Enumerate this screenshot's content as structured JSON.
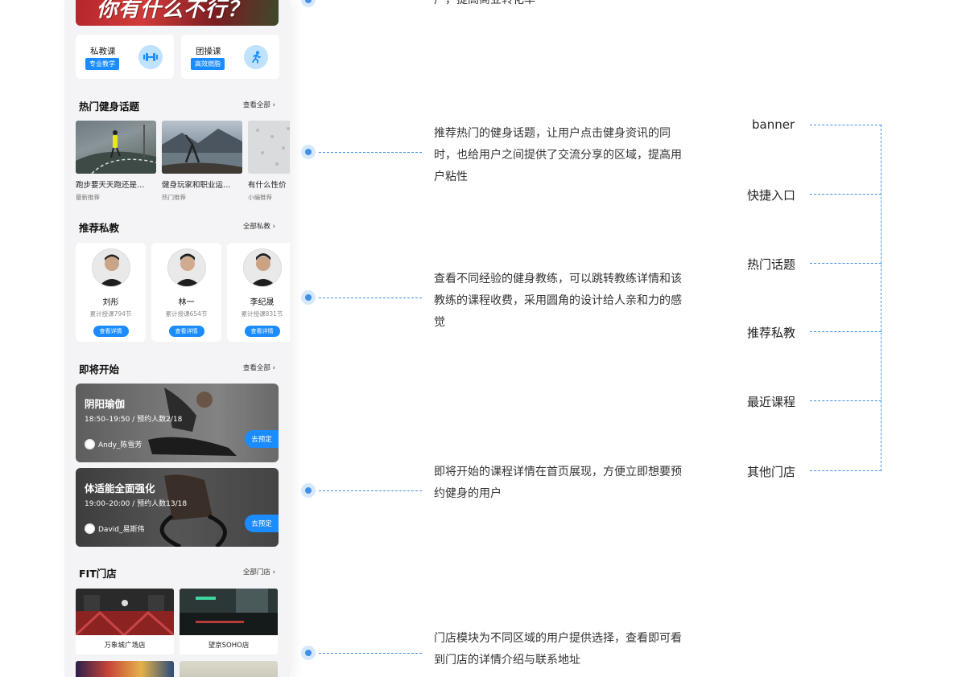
{
  "phone": {
    "banner_text": "你有什么不行？",
    "quick": [
      {
        "title": "私教课",
        "tag": "专业教学",
        "icon": "dumbbell-icon"
      },
      {
        "title": "团操课",
        "tag": "高效燃脂",
        "icon": "running-icon"
      }
    ],
    "topics_section": {
      "title": "热门健身话题",
      "more": "查看全部"
    },
    "topics": [
      {
        "title": "跑步要天天跑还是…",
        "sub": "最新推荐"
      },
      {
        "title": "健身玩家和职业运…",
        "sub": "热门推荐"
      },
      {
        "title": "有什么性价",
        "sub": "小编推荐"
      }
    ],
    "coach_section": {
      "title": "推荐私教",
      "more": "全部私教"
    },
    "coaches": [
      {
        "name": "刘彤",
        "count": "累计授课794节",
        "btn": "查看详情"
      },
      {
        "name": "林一",
        "count": "累计授课654节",
        "btn": "查看详情"
      },
      {
        "name": "李纪晟",
        "count": "累计授课831节",
        "btn": "查看详情"
      }
    ],
    "upcoming_section": {
      "title": "即将开始",
      "more": "查看全部"
    },
    "classes": [
      {
        "name": "阴阳瑜伽",
        "time": "18:50–19:50 / 预约人数2/18",
        "coach": "Andy_陈雪芳",
        "btn": "去预定"
      },
      {
        "name": "体适能全面强化",
        "time": "19:00–20:00 / 预约人数13/18",
        "coach": "David_易斯伟",
        "btn": "去预定"
      }
    ],
    "stores_section": {
      "title": "FIT门店",
      "more": "全部门店"
    },
    "stores": [
      {
        "name": "万象城广场店"
      },
      {
        "name": "望京SOHO店"
      }
    ]
  },
  "descriptions": {
    "top_partial": "广，提高商业转化率",
    "topics": "推荐热门的健身话题，让用户点击健身资讯的同时，也给用户之间提供了交流分享的区域，提高用户粘性",
    "coaches": "查看不同经验的健身教练，可以跳转教练详情和该教练的课程收费，采用圆角的设计给人亲和力的感觉",
    "classes": "即将开始的课程详情在首页展现，方便立即想要预约健身的用户",
    "stores": "门店模块为不同区域的用户提供选择，查看即可看到门店的详情介绍与联系地址"
  },
  "structure_labels": [
    "banner",
    "快捷入口",
    "热门话题",
    "推荐私教",
    "最近课程",
    "其他门店"
  ],
  "colors": {
    "accent": "#1a8cff",
    "annotation": "#3f91e8"
  }
}
